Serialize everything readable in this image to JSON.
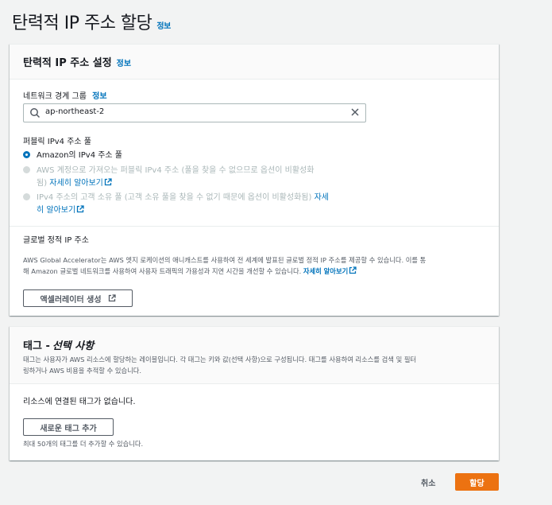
{
  "page": {
    "title": "탄력적 IP 주소 할당",
    "info": "정보"
  },
  "settings": {
    "title": "탄력적 IP 주소 설정",
    "info": "정보",
    "network_border_group": {
      "label": "네트워크 경계 그룹",
      "info": "정보",
      "value": "ap-northeast-2"
    },
    "pool_label": "퍼블릭 IPv4 주소 풀",
    "options": [
      {
        "label": "Amazon의 IPv4 주소 풀",
        "selected": true,
        "disabled": false
      },
      {
        "line1": "AWS 계정으로 가져오는 퍼블릭 IPv4 주소 (풀을 찾을 수 없으므로 옵션이 비활성화",
        "line2": "됨)",
        "link": "자세히 알아보기",
        "selected": false,
        "disabled": true
      },
      {
        "line1": "IPv4 주소의 고객 소유 풀 (고객 소유 풀을 찾을 수 없기 때문에 옵션이 비활성화됨)",
        "link1": "자세",
        "link2": "히 알아보기",
        "selected": false,
        "disabled": true
      }
    ],
    "global": {
      "label": "글로벌 정적 IP 주소",
      "desc_line1": "AWS Global Accelerator는 AWS 엣지 로케이션의 애니캐스트를 사용하여 전 세계에 발표된 글로벌 정적 IP 주소를 제공할 수 있습니다. 이를 통",
      "desc_line2": "해 Amazon 글로벌 네트워크를 사용하여 사용자 트래픽의 가용성과 지연 시간을 개선할 수 있습니다.",
      "link": "자세히 알아보기",
      "button": "액셀러레이터 생성"
    }
  },
  "tags": {
    "title": "태그 - ",
    "title_optional": "선택 사항",
    "desc_line1": "태그는 사용자가 AWS 리소스에 할당하는 레이블입니다. 각 태그는 키와 값(선택 사항)으로 구성됩니다. 태그를 사용하여 리소스를 검색 및 필터",
    "desc_line2": "링하거나 AWS 비용을 추적할 수 있습니다.",
    "empty": "리소스에 연결된 태그가 없습니다.",
    "add_button": "새로운 태그 추가",
    "hint": "최대 50개의 태그를 더 추가할 수 있습니다."
  },
  "footer": {
    "cancel": "취소",
    "submit": "할당"
  },
  "colors": {
    "accent": "#0073bb",
    "primary": "#ec7211"
  }
}
